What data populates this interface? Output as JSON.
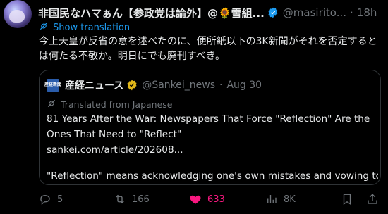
{
  "tweet": {
    "display_name": "非国民なハマぁん【参政党は論外】@🌻雪組...",
    "handle": "@masirito...",
    "separator": "·",
    "time": "18h",
    "show_translation": "Show translation",
    "text": "今上天皇が反省の意を述べたのに、便所紙以下の3K新聞がそれを否定するとは何たる不敬か。明日にでも廃刊すべき。"
  },
  "quote": {
    "logo_text": "産経新聞",
    "name": "産経ニュース",
    "handle": "@Sankei_news",
    "separator": "·",
    "date": "Aug 30",
    "translated_from": "Translated from Japanese",
    "line1": "81 Years After the War: Newspapers That Force \"Reflection\" Are the Ones That Need to \"Reflect\"",
    "link": "sankei.com/article/202608...",
    "line2": "\"Reflection\" means acknowledging one's own mistakes and vowing to ..."
  },
  "actions": {
    "replies": "5",
    "reposts": "166",
    "likes": "633",
    "views": "8K"
  },
  "colors": {
    "accent": "#1d9bf0",
    "like": "#f91880",
    "muted": "#71767b",
    "gold_badge": "#e2b719"
  },
  "icons": [
    "avatar",
    "verified-badge-icon",
    "grok-icon",
    "more-icon",
    "translate-icon",
    "sankei-logo",
    "gold-verified-icon",
    "reply-icon",
    "repost-icon",
    "like-icon",
    "views-icon",
    "bookmark-icon",
    "share-icon"
  ]
}
